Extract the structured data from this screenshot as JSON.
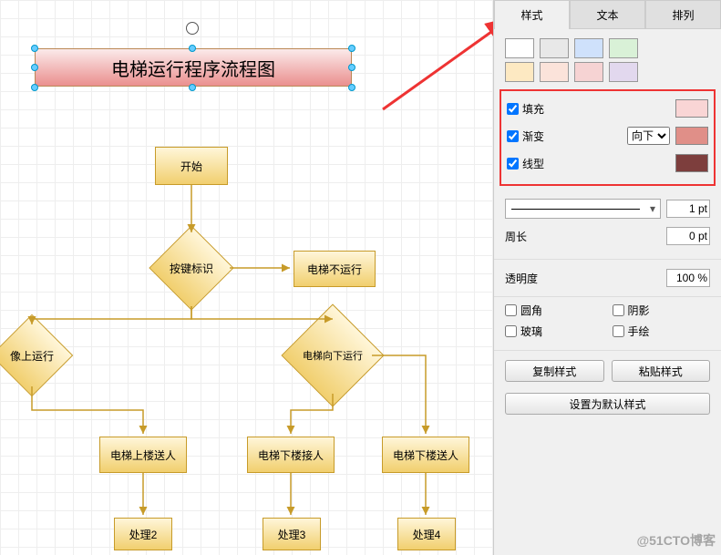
{
  "tabs": {
    "style": "样式",
    "text": "文本",
    "arrange": "排列"
  },
  "swatches_row1": [
    "#ffffff",
    "#e8e8e8",
    "#cfe1fb",
    "#d9f1d7"
  ],
  "swatches_row2": [
    "#fde9c2",
    "#fbe3da",
    "#f6d3d3",
    "#e2d8ee"
  ],
  "props": {
    "fill": {
      "label": "填充",
      "checked": true,
      "color": "#f9d5d5"
    },
    "gradient": {
      "label": "渐变",
      "checked": true,
      "dir": "向下",
      "color": "#e08f88"
    },
    "line": {
      "label": "线型",
      "checked": true,
      "color": "#7d3e3d"
    },
    "width_val": "1 pt",
    "perimeter": {
      "label": "周长",
      "value": "0 pt"
    },
    "opacity": {
      "label": "透明度",
      "value": "100 %"
    },
    "rounded": "圆角",
    "shadow": "阴影",
    "glass": "玻璃",
    "sketch": "手绘",
    "copy_style": "复制样式",
    "paste_style": "粘贴样式",
    "set_default": "设置为默认样式"
  },
  "flow": {
    "title": "电梯运行程序流程图",
    "start": "开始",
    "key_flag": "按键标识",
    "no_run": "电梯不运行",
    "up": "像上运行",
    "down": "电梯向下运行",
    "up_send": "电梯上楼送人",
    "down_recv": "电梯下楼接人",
    "down_send": "电梯下楼送人",
    "p2": "处理2",
    "p3": "处理3",
    "p4": "处理4"
  },
  "watermark": "@51CTO博客"
}
